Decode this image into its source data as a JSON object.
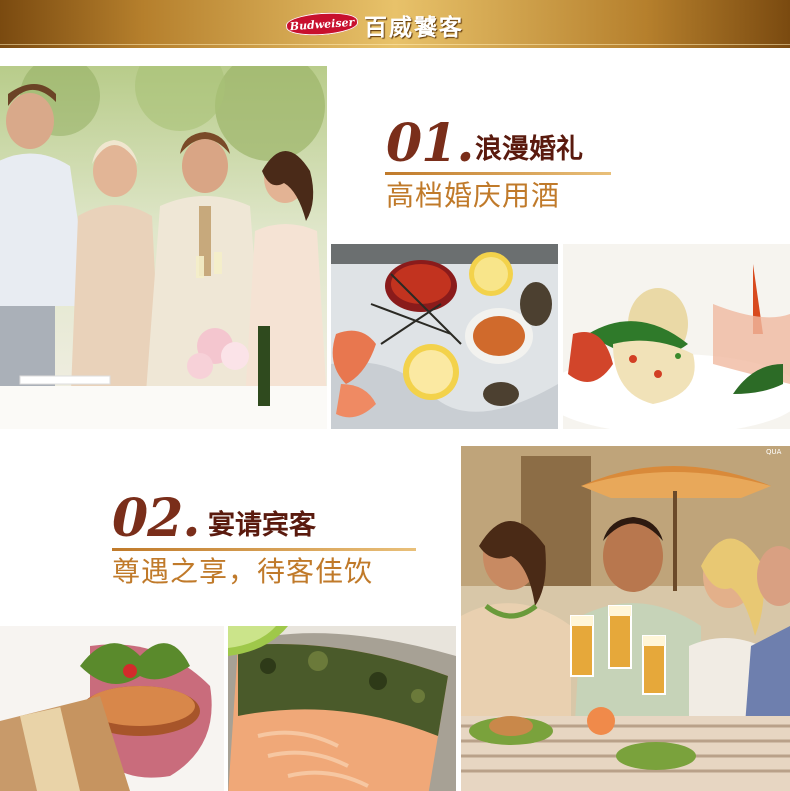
{
  "header": {
    "logo_text": "Budweiser",
    "brand_name": "百威饕客",
    "colors": {
      "gold_dark": "#7a4a10",
      "gold_light": "#e8c26a",
      "logo_red": "#c8102e"
    }
  },
  "sections": [
    {
      "number": "01.",
      "title": "浪漫婚礼",
      "subtitle": "高档婚庆用酒"
    },
    {
      "number": "02.",
      "title": "宴请宾客",
      "subtitle": "尊遇之享，待客佳饮"
    }
  ],
  "photos": {
    "wedding": "wedding-toast-photo",
    "seafood": "seafood-platter-photo",
    "salad": "gourmet-dish-photo",
    "party": "friends-toast-photo",
    "dish_left": "plated-dish-photo",
    "salmon": "grilled-salmon-photo"
  },
  "watermark": "QUA"
}
